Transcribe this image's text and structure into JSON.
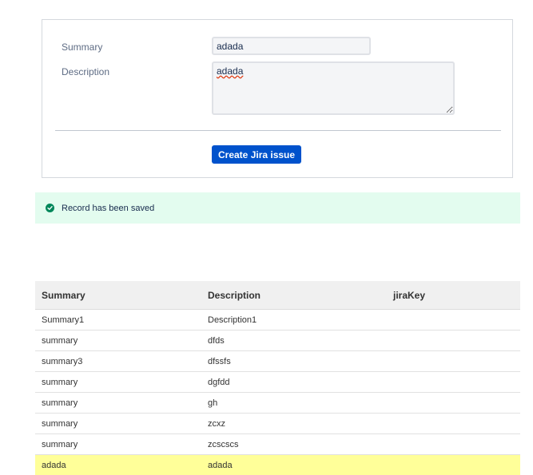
{
  "form": {
    "summary_label": "Summary",
    "summary_value": "adada",
    "description_label": "Description",
    "description_value": "adada",
    "create_button_label": "Create Jira issue"
  },
  "flag": {
    "message": "Record has been saved",
    "icon": "check-circle-icon",
    "color": "#00875a",
    "background": "#e3fcef"
  },
  "table": {
    "headers": [
      "Summary",
      "Description",
      "jiraKey"
    ],
    "rows": [
      [
        "Summary1",
        "Description1",
        ""
      ],
      [
        "summary",
        "dfds",
        ""
      ],
      [
        "summary3",
        "dfssfs",
        ""
      ],
      [
        "summary",
        "dgfdd",
        ""
      ],
      [
        "summary",
        "gh",
        ""
      ],
      [
        "summary",
        "zcxz",
        ""
      ],
      [
        "summary",
        "zcscscs",
        ""
      ],
      [
        "adada",
        "adada",
        ""
      ]
    ],
    "highlight_color": "#ffff99"
  },
  "colors": {
    "primary_button": "#0052cc"
  }
}
